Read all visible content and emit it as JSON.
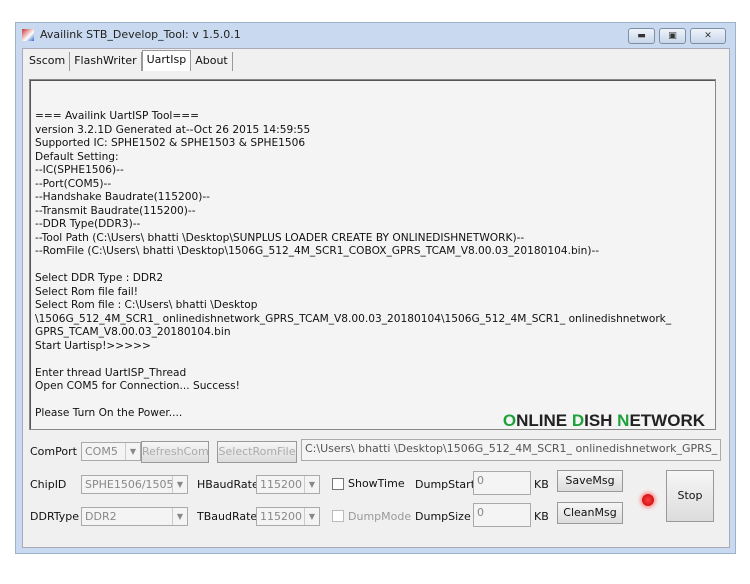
{
  "window": {
    "title": "Availink STB_Develop_Tool: v 1.5.0.1",
    "controls": [
      "minimize",
      "maximize",
      "close"
    ]
  },
  "tabs": [
    {
      "label": "Sscom"
    },
    {
      "label": "FlashWriter"
    },
    {
      "label": "UartIsp",
      "active": true
    },
    {
      "label": "About"
    }
  ],
  "log": {
    "lines": [
      "=== Availink UartISP Tool===",
      "version 3.2.1D Generated at--Oct 26 2015 14:59:55",
      "Supported IC: SPHE1502 & SPHE1503 & SPHE1506",
      "Default Setting:",
      "--IC(SPHE1506)--",
      "--Port(COM5)--",
      "--Handshake Baudrate(115200)--",
      "--Transmit Baudrate(115200)--",
      "--DDR Type(DDR3)--",
      "--Tool Path (C:\\Users\\ bhatti \\Desktop\\SUNPLUS LOADER CREATE BY ONLINEDISHNETWORK)--",
      "--RomFile (C:\\Users\\ bhatti \\Desktop\\1506G_512_4M_SCR1_COBOX_GPRS_TCAM_V8.00.03_20180104.bin)--",
      "",
      "Select DDR Type : DDR2",
      "Select Rom file fail!",
      "Select Rom file : C:\\Users\\ bhatti \\Desktop",
      "\\1506G_512_4M_SCR1_ onlinedishnetwork_GPRS_TCAM_V8.00.03_20180104\\1506G_512_4M_SCR1_ onlinedishnetwork_",
      "GPRS_TCAM_V8.00.03_20180104.bin",
      "Start Uartisp!>>>>>",
      "",
      "Enter thread UartISP_Thread",
      "Open COM5 for Connection... Success!",
      "",
      "Please Turn On the Power...."
    ]
  },
  "watermark": {
    "part1": "O",
    "part2": "NLINE ",
    "part3": "D",
    "part4": "ISH ",
    "part5": "N",
    "part6": "ETWORK",
    "accent": "#1fa23a"
  },
  "controls": {
    "comport_label": "ComPort",
    "comport_value": "COM5",
    "refresh_label": "RefreshCom",
    "select_rom_label": "SelectRomFile",
    "rom_path": "C:\\Users\\ bhatti \\Desktop\\1506G_512_4M_SCR1_ onlinedishnetwork_GPRS_",
    "chipid_label": "ChipID",
    "chipid_value": "SPHE1506/1505",
    "hbaud_label": "HBaudRate",
    "hbaud_value": "115200",
    "tbaud_label": "TBaudRate",
    "tbaud_value": "115200",
    "ddrtype_label": "DDRType",
    "ddrtype_value": "DDR2",
    "showtime_label": "ShowTime",
    "showtime_checked": false,
    "dumpmode_label": "DumpMode",
    "dumpmode_checked": false,
    "dumpstart_label": "DumpStart",
    "dumpstart_value": "0",
    "dumpsize_label": "DumpSize",
    "dumpsize_value": "0",
    "kb_label": "KB",
    "savemsg_label": "SaveMsg",
    "cleanmsg_label": "CleanMsg",
    "stop_label": "Stop",
    "status_led_color": "#ff0000"
  }
}
